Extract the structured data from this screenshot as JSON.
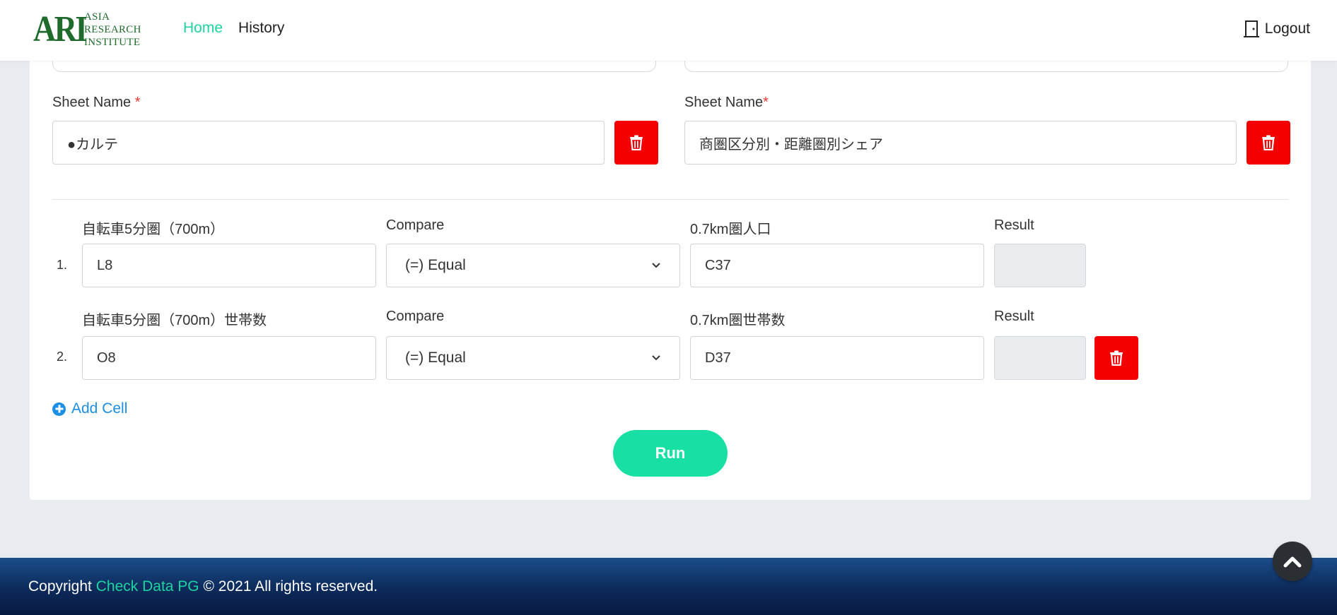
{
  "header": {
    "logo_main": "ARI",
    "logo_line1": "ASIA",
    "logo_line2": "RESEARCH",
    "logo_line3": "INSTITUTE",
    "nav": [
      {
        "label": "Home",
        "active": true
      },
      {
        "label": "History",
        "active": false
      }
    ],
    "logout_label": "Logout"
  },
  "sheets": {
    "left": {
      "label": "Sheet Name",
      "required_mark": "*",
      "value": "●カルテ"
    },
    "right": {
      "label": "Sheet Name",
      "required_mark": "*",
      "value": "商圏区分別・距離圏別シェア"
    }
  },
  "rows": [
    {
      "number": "1.",
      "left_label": "自転車5分圏（700m）",
      "left_value": "L8",
      "compare_label": "Compare",
      "compare_value": "(=) Equal",
      "right_label": "0.7km圏人口",
      "right_value": "C37",
      "result_label": "Result"
    },
    {
      "number": "2.",
      "left_label": "自転車5分圏（700m）世帯数",
      "left_value": "O8",
      "compare_label": "Compare",
      "compare_value": "(=) Equal",
      "right_label": "0.7km圏世帯数",
      "right_value": "D37",
      "result_label": "Result"
    }
  ],
  "actions": {
    "add_cell_label": "Add Cell",
    "run_label": "Run"
  },
  "footer": {
    "copyright_prefix": "Copyright",
    "brand": "Check Data PG",
    "copyright_suffix": "© 2021 All rights reserved."
  },
  "colors": {
    "accent": "#1dd4a1",
    "danger": "#f40000",
    "link": "#1a8fe3",
    "logo": "#1e6b2c"
  }
}
